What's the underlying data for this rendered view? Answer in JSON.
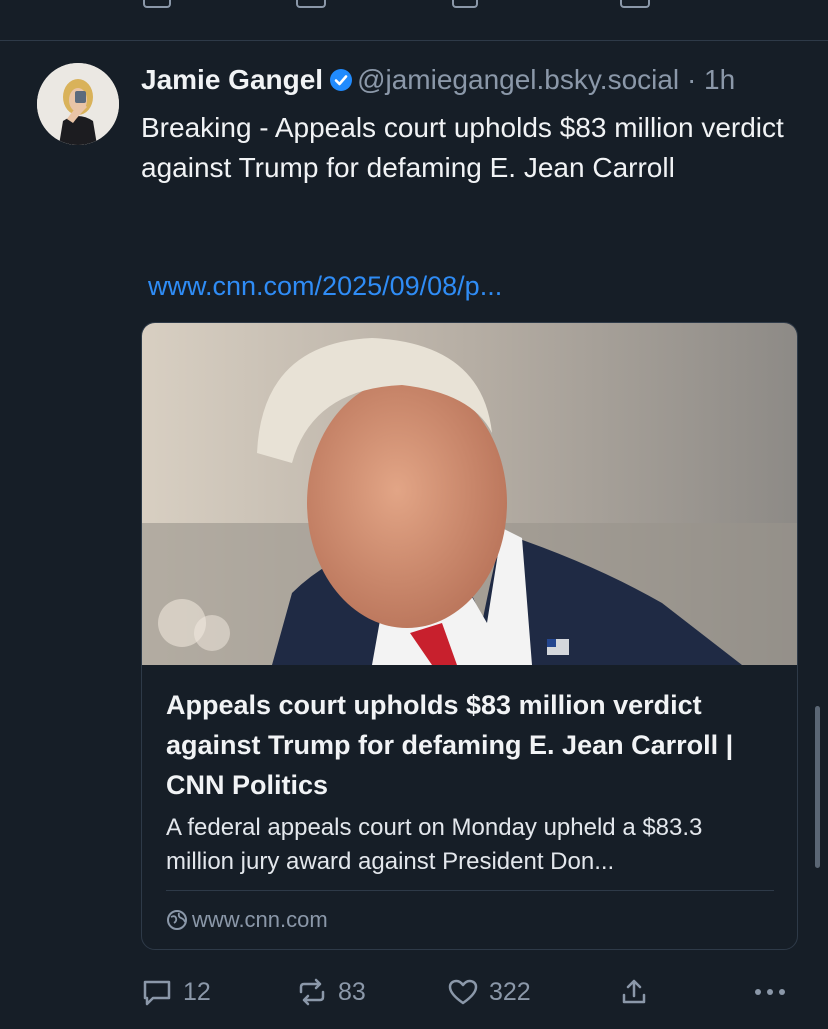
{
  "post": {
    "author_name": "Jamie Gangel",
    "handle": "@jamiegangel.bsky.social",
    "separator": "·",
    "time": "1h",
    "text": "Breaking - Appeals court upholds $83 million verdict against Trump for defaming E. Jean Carroll",
    "link_text": "www.cnn.com/2025/09/08/p..."
  },
  "card": {
    "title": "Appeals court upholds $83 million verdict against Trump for defaming E. Jean Carroll | CNN Politics",
    "description": "A federal appeals court on Monday upheld a $83.3 million jury award against President Don...",
    "domain": "www.cnn.com"
  },
  "actions": {
    "replies": "12",
    "reposts": "83",
    "likes": "322"
  },
  "icons": {
    "verified": "verified-badge-icon",
    "reply": "reply-icon",
    "repost": "repost-icon",
    "like": "heart-icon",
    "share": "share-icon",
    "more": "more-icon",
    "globe": "globe-icon"
  },
  "colors": {
    "background": "#161e27",
    "link": "#2f8cf5",
    "muted": "#8b98a9",
    "border": "#2e3a48",
    "verified": "#208bfe"
  }
}
